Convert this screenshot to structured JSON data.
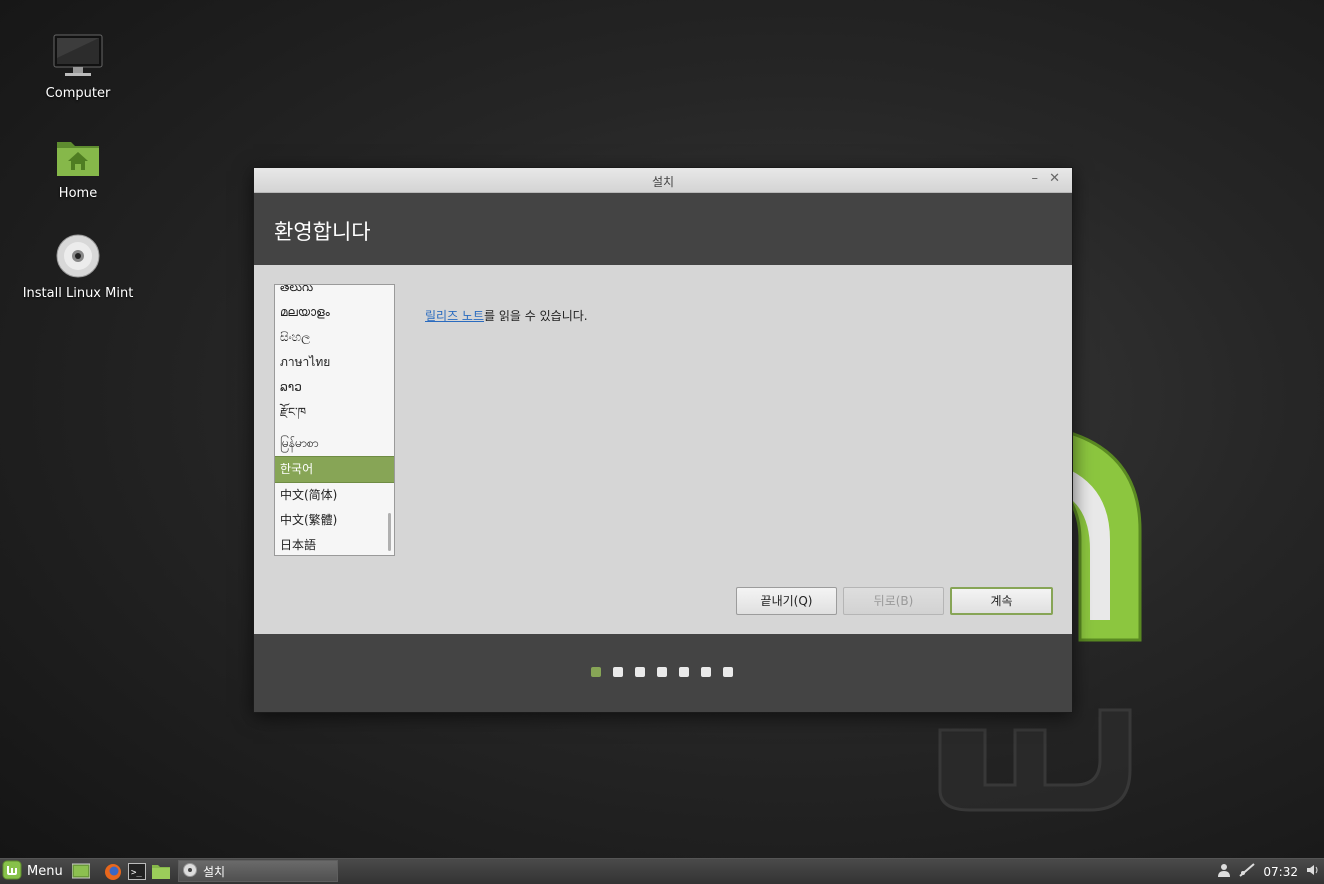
{
  "desktop": {
    "icons": [
      {
        "label": "Computer",
        "icon": "monitor-icon"
      },
      {
        "label": "Home",
        "icon": "home-folder-icon"
      },
      {
        "label": "Install Linux Mint",
        "icon": "disc-icon"
      }
    ]
  },
  "window": {
    "title": "설치",
    "minimize": "–",
    "close": "✕",
    "header": "환영합니다",
    "languages": [
      "తెలుగు",
      "മലയാളം",
      "සිංහල",
      "ภาษาไทย",
      "ລາວ",
      "རྫོང་ཁ",
      "မြန်မာစာ",
      "한국어",
      "中文(简体)",
      "中文(繁體)",
      "日本語"
    ],
    "selected_language": "한국어",
    "release_notes_link": "릴리즈 노트",
    "release_notes_text": "를 읽을 수 있습니다.",
    "buttons": {
      "quit": "끝내기(Q)",
      "back": "뒤로(B)",
      "continue": "계속"
    },
    "progress": {
      "current": 1,
      "total": 7
    }
  },
  "taskbar": {
    "menu_label": "Menu",
    "task_label": "설치",
    "clock": "07:32"
  },
  "colors": {
    "accent": "#87a556"
  }
}
